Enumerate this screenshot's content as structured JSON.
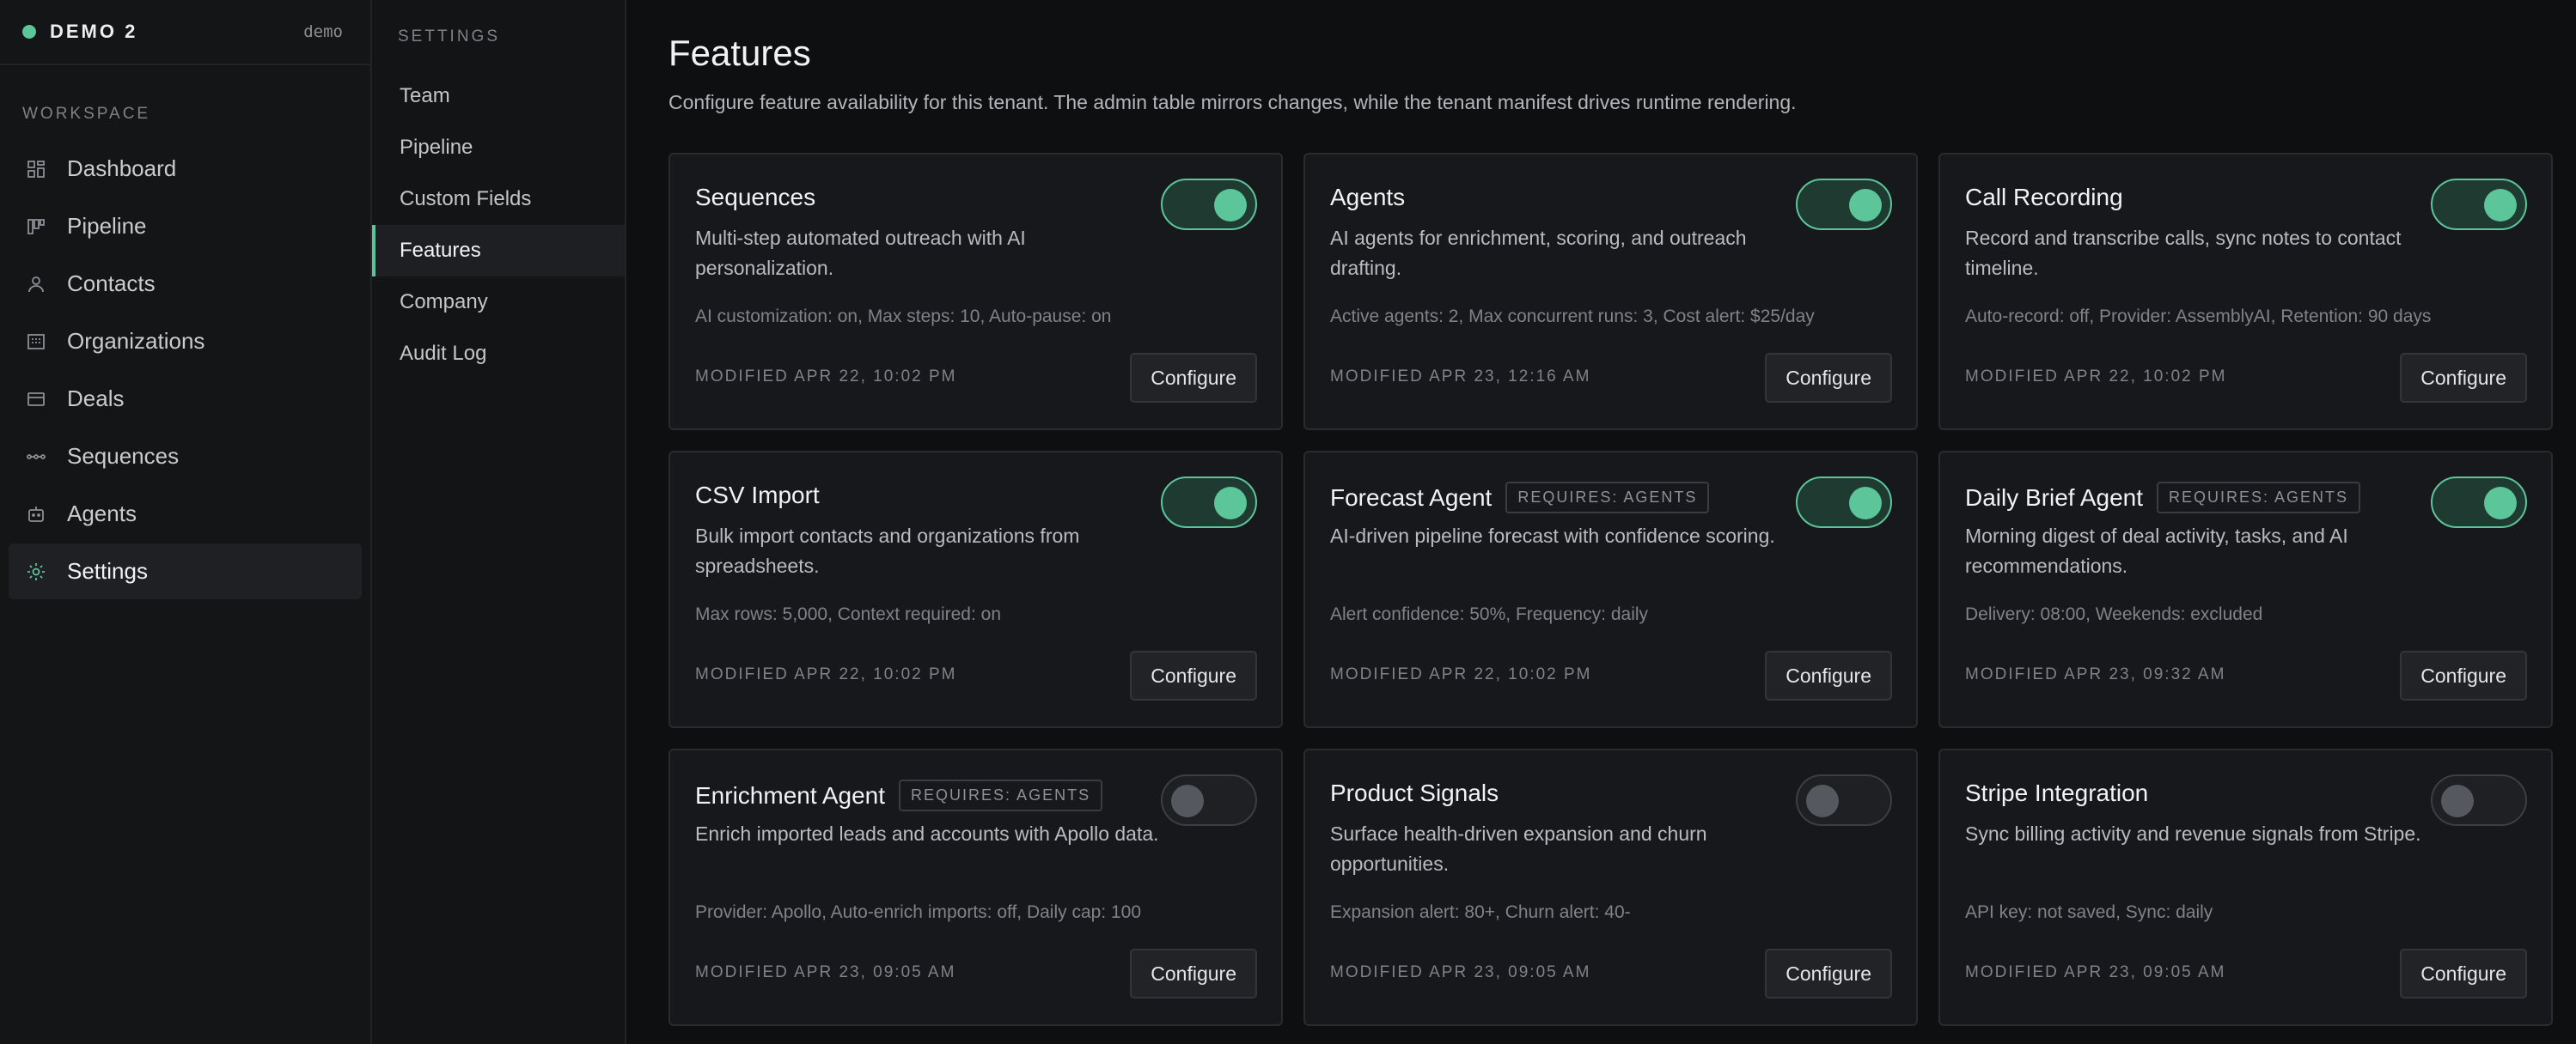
{
  "brand": {
    "name": "DEMO 2",
    "env": "demo",
    "dot_color": "#5cc59a"
  },
  "sidebar": {
    "section_label": "WORKSPACE",
    "items": [
      {
        "label": "Dashboard",
        "icon": "dashboard-icon",
        "active": false
      },
      {
        "label": "Pipeline",
        "icon": "pipeline-icon",
        "active": false
      },
      {
        "label": "Contacts",
        "icon": "contacts-icon",
        "active": false
      },
      {
        "label": "Organizations",
        "icon": "organizations-icon",
        "active": false
      },
      {
        "label": "Deals",
        "icon": "deals-icon",
        "active": false
      },
      {
        "label": "Sequences",
        "icon": "sequences-icon",
        "active": false
      },
      {
        "label": "Agents",
        "icon": "agents-icon",
        "active": false
      },
      {
        "label": "Settings",
        "icon": "settings-icon",
        "active": true
      }
    ]
  },
  "settings_nav": {
    "title": "SETTINGS",
    "items": [
      {
        "label": "Team",
        "active": false
      },
      {
        "label": "Pipeline",
        "active": false
      },
      {
        "label": "Custom Fields",
        "active": false
      },
      {
        "label": "Features",
        "active": true
      },
      {
        "label": "Company",
        "active": false
      },
      {
        "label": "Audit Log",
        "active": false
      }
    ]
  },
  "page": {
    "title": "Features",
    "description": "Configure feature availability for this tenant. The admin table mirrors changes, while the tenant manifest drives runtime rendering."
  },
  "accent_color": "#5cc59a",
  "configure_label": "Configure",
  "features": [
    {
      "title": "Sequences",
      "badge": "",
      "enabled": true,
      "description": "Multi-step automated outreach with AI personalization.",
      "meta": "AI customization: on, Max steps: 10, Auto-pause: on",
      "modified": "MODIFIED APR 22, 10:02 PM"
    },
    {
      "title": "Agents",
      "badge": "",
      "enabled": true,
      "description": "AI agents for enrichment, scoring, and outreach drafting.",
      "meta": "Active agents: 2, Max concurrent runs: 3, Cost alert: $25/day",
      "modified": "MODIFIED APR 23, 12:16 AM"
    },
    {
      "title": "Call Recording",
      "badge": "",
      "enabled": true,
      "description": "Record and transcribe calls, sync notes to contact timeline.",
      "meta": "Auto-record: off, Provider: AssemblyAI, Retention: 90 days",
      "modified": "MODIFIED APR 22, 10:02 PM"
    },
    {
      "title": "CSV Import",
      "badge": "",
      "enabled": true,
      "description": "Bulk import contacts and organizations from spreadsheets.",
      "meta": "Max rows: 5,000, Context required: on",
      "modified": "MODIFIED APR 22, 10:02 PM"
    },
    {
      "title": "Forecast Agent",
      "badge": "REQUIRES: AGENTS",
      "enabled": true,
      "description": "AI-driven pipeline forecast with confidence scoring.",
      "meta": "Alert confidence: 50%, Frequency: daily",
      "modified": "MODIFIED APR 22, 10:02 PM"
    },
    {
      "title": "Daily Brief Agent",
      "badge": "REQUIRES: AGENTS",
      "enabled": true,
      "description": "Morning digest of deal activity, tasks, and AI recommendations.",
      "meta": "Delivery: 08:00, Weekends: excluded",
      "modified": "MODIFIED APR 23, 09:32 AM"
    },
    {
      "title": "Enrichment Agent",
      "badge": "REQUIRES: AGENTS",
      "enabled": false,
      "description": "Enrich imported leads and accounts with Apollo data.",
      "meta": "Provider: Apollo, Auto-enrich imports: off, Daily cap: 100",
      "modified": "MODIFIED APR 23, 09:05 AM"
    },
    {
      "title": "Product Signals",
      "badge": "",
      "enabled": false,
      "description": "Surface health-driven expansion and churn opportunities.",
      "meta": "Expansion alert: 80+, Churn alert: 40-",
      "modified": "MODIFIED APR 23, 09:05 AM"
    },
    {
      "title": "Stripe Integration",
      "badge": "",
      "enabled": false,
      "description": "Sync billing activity and revenue signals from Stripe.",
      "meta": "API key: not saved, Sync: daily",
      "modified": "MODIFIED APR 23, 09:05 AM"
    }
  ]
}
